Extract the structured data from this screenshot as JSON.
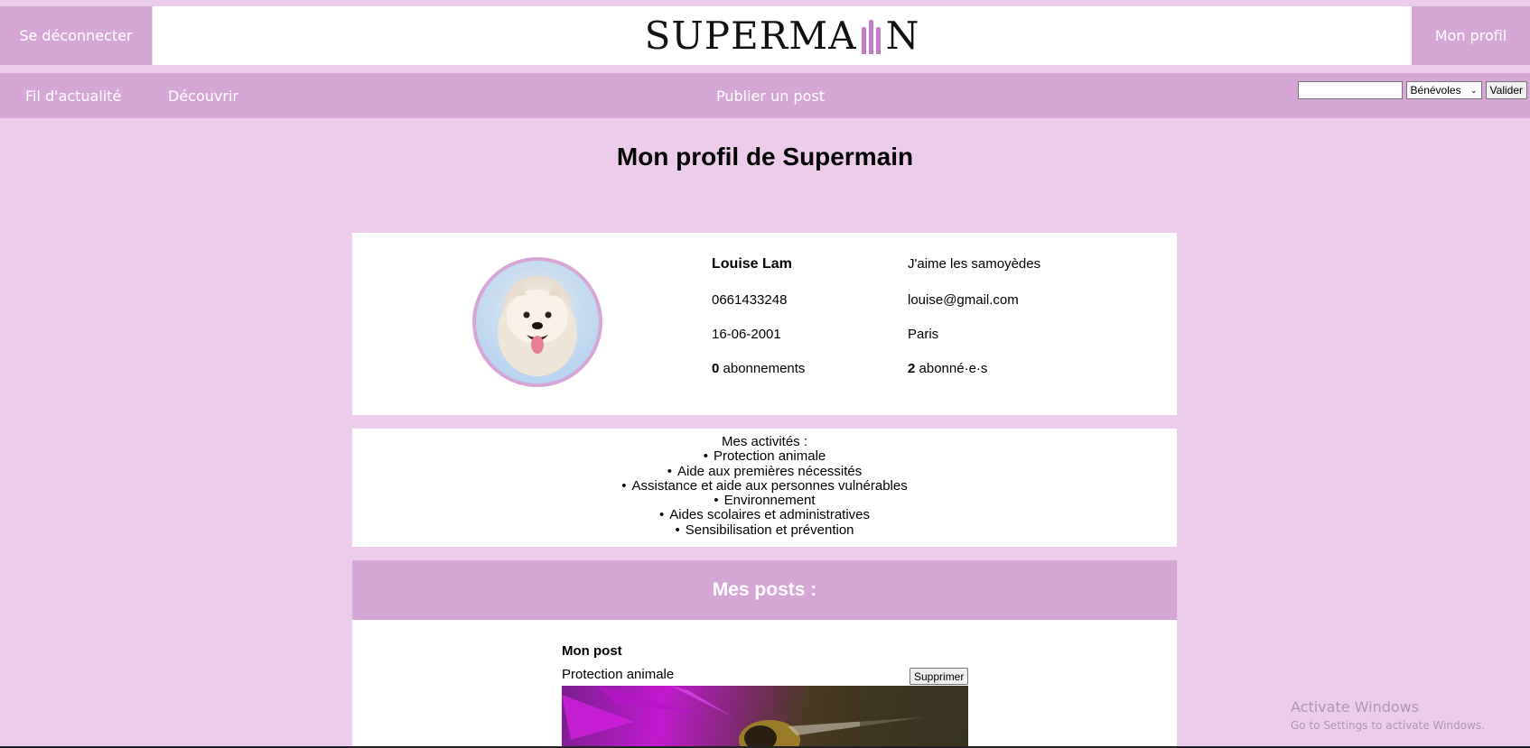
{
  "header": {
    "logout_label": "Se déconnecter",
    "logo_text_left": "SUPERMA",
    "logo_text_right": "N",
    "profile_label": "Mon profil"
  },
  "nav": {
    "feed": "Fil d'actualité",
    "discover": "Découvrir",
    "publish": "Publier un post",
    "search": {
      "value": "",
      "placeholder": ""
    },
    "select_value": "Bénévoles",
    "submit": "Valider"
  },
  "page_title": "Mon profil de Supermain",
  "profile": {
    "name": "Louise Lam",
    "bio": "J'aime les samoyèdes",
    "phone": "0661433248",
    "email": "louise@gmail.com",
    "birthdate": "16-06-2001",
    "city": "Paris",
    "subscriptions_count": "0",
    "subscriptions_label": "abonnements",
    "followers_count": "2",
    "followers_label": "abonné·e·s"
  },
  "activities": {
    "title": "Mes activités :",
    "items": [
      "Protection animale",
      "Aide aux premières nécessités",
      "Assistance et aide aux personnes vulnérables",
      "Environnement",
      "Aides scolaires et administratives",
      "Sensibilisation et prévention"
    ]
  },
  "posts": {
    "header": "Mes posts :",
    "items": [
      {
        "title": "Mon post",
        "category": "Protection animale",
        "delete_label": "Supprimer"
      }
    ]
  },
  "watermark": {
    "line1": "Activate Windows",
    "line2": "Go to Settings to activate Windows."
  },
  "colors": {
    "accent": "#d5a6d6",
    "background": "#ecccea"
  }
}
